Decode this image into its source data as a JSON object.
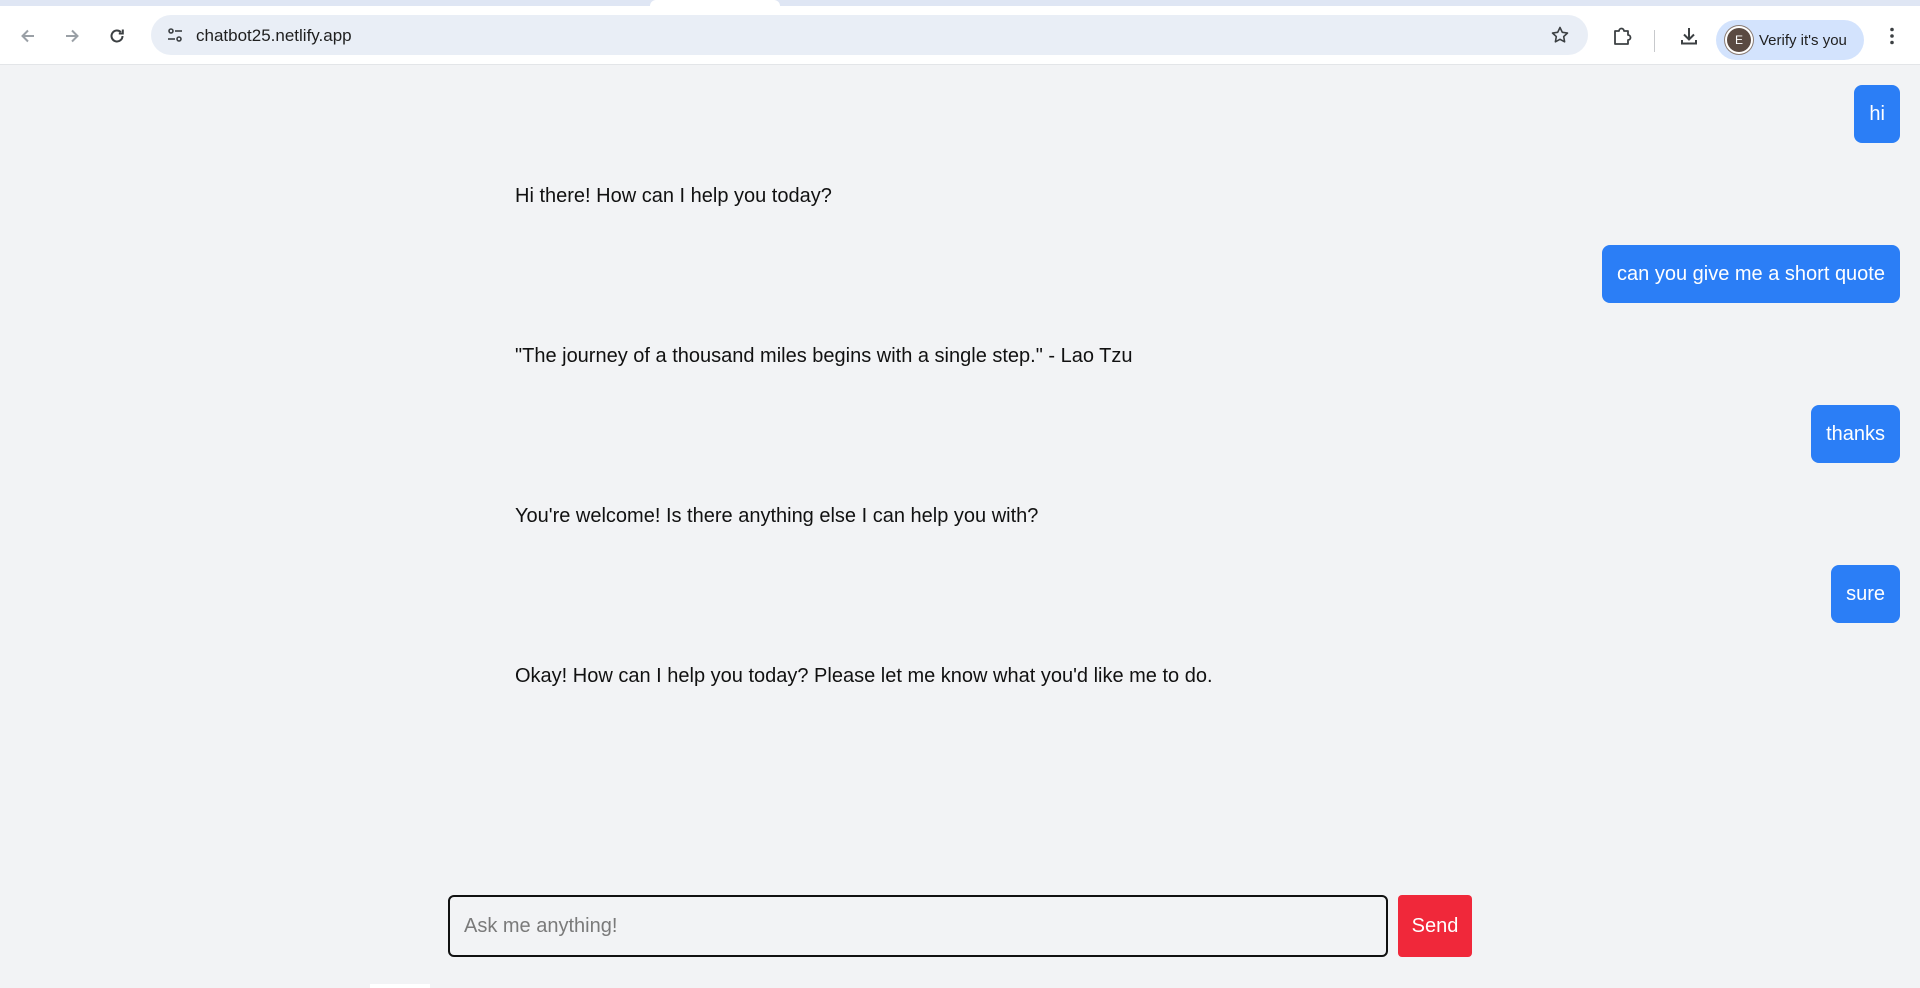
{
  "browser": {
    "url": "chatbot25.netlify.app",
    "profile_initial": "E",
    "profile_label": "Verify it's you",
    "icons": [
      "back-icon",
      "forward-icon",
      "reload-icon",
      "site-info-icon",
      "bookmark-star-icon",
      "extensions-icon",
      "download-icon",
      "menu-icon"
    ]
  },
  "chat": {
    "messages": [
      {
        "role": "user",
        "text": "hi"
      },
      {
        "role": "bot",
        "text": "Hi there! How can I help you today?"
      },
      {
        "role": "user",
        "text": "can you give me a short quote"
      },
      {
        "role": "bot",
        "text": "\"The journey of a thousand miles begins with a single step.\" - Lao Tzu"
      },
      {
        "role": "user",
        "text": "thanks"
      },
      {
        "role": "bot",
        "text": "You're welcome!  Is there anything else I can help you with?"
      },
      {
        "role": "user",
        "text": "sure"
      },
      {
        "role": "bot",
        "text": "Okay!  How can I help you today?  Please let me know what you'd like me to do."
      }
    ],
    "input": {
      "value": "",
      "placeholder": "Ask me anything!"
    },
    "send_label": "Send"
  },
  "colors": {
    "user_bubble": "#2b7ef6",
    "send_button": "#f0283a",
    "page_background": "#f2f3f5"
  }
}
